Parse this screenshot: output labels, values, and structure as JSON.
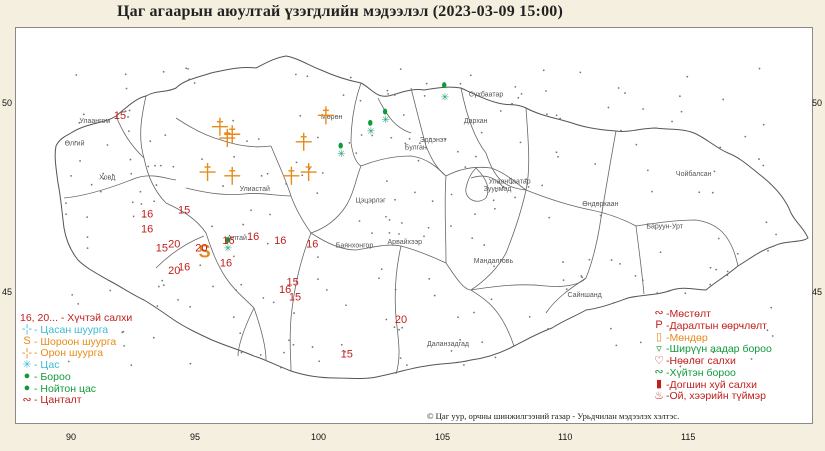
{
  "title": "Цаг агаарын аюултай үзэгдлийн мэдээлэл (2023-03-09 15:00)",
  "credit": "© Цаг уур, орчны шинжилгээний газар - Урьдчилан мэдээлэх хэлтэс.",
  "axes": {
    "lat_labels_left": [
      "50",
      "45"
    ],
    "lat_labels_right": [
      "50",
      "45"
    ],
    "lon_labels": [
      "90",
      "95",
      "100",
      "105",
      "110",
      "115"
    ]
  },
  "regions": [
    {
      "name": "Улаангом",
      "lon": 90.3,
      "lat": 49.5
    },
    {
      "name": "Өлгий",
      "lon": 89.7,
      "lat": 48.9
    },
    {
      "name": "Ховд",
      "lon": 91.1,
      "lat": 48.0
    },
    {
      "name": "Мөрөн",
      "lon": 100.1,
      "lat": 49.6
    },
    {
      "name": "Сүхбаатар",
      "lon": 106.1,
      "lat": 50.2
    },
    {
      "name": "Дархан",
      "lon": 105.9,
      "lat": 49.5
    },
    {
      "name": "Эрдэнэт",
      "lon": 104.1,
      "lat": 49.0
    },
    {
      "name": "Булган",
      "lon": 103.5,
      "lat": 48.8
    },
    {
      "name": "Улаанбаатар",
      "lon": 106.9,
      "lat": 47.9
    },
    {
      "name": "Зуунмод",
      "lon": 106.7,
      "lat": 47.7
    },
    {
      "name": "Баруун-Урт",
      "lon": 113.3,
      "lat": 46.7
    },
    {
      "name": "Чойбалсан",
      "lon": 114.5,
      "lat": 48.1
    },
    {
      "name": "Өндөрхаан",
      "lon": 110.7,
      "lat": 47.3
    },
    {
      "name": "Улиастай",
      "lon": 96.8,
      "lat": 47.7
    },
    {
      "name": "Алтай",
      "lon": 96.3,
      "lat": 46.4
    },
    {
      "name": "Арвайхээр",
      "lon": 102.8,
      "lat": 46.3
    },
    {
      "name": "Цэцэрлэг",
      "lon": 101.5,
      "lat": 47.4
    },
    {
      "name": "Баянхонгор",
      "lon": 100.7,
      "lat": 46.2
    },
    {
      "name": "Мандалговь",
      "lon": 106.3,
      "lat": 45.8
    },
    {
      "name": "Сайншанд",
      "lon": 110.1,
      "lat": 44.9
    },
    {
      "name": "Даланзадгад",
      "lon": 104.4,
      "lat": 43.6
    }
  ],
  "wind_labels": [
    {
      "text": "15",
      "lon": 91.7,
      "lat": 49.6
    },
    {
      "text": "15",
      "lon": 94.3,
      "lat": 47.1
    },
    {
      "text": "16",
      "lon": 92.8,
      "lat": 47.0
    },
    {
      "text": "16",
      "lon": 92.8,
      "lat": 46.6
    },
    {
      "text": "15",
      "lon": 93.4,
      "lat": 46.1
    },
    {
      "text": "20",
      "lon": 93.9,
      "lat": 46.2
    },
    {
      "text": "20",
      "lon": 95.0,
      "lat": 46.1
    },
    {
      "text": "16",
      "lon": 96.1,
      "lat": 46.3
    },
    {
      "text": "16",
      "lon": 97.1,
      "lat": 46.4
    },
    {
      "text": "16",
      "lon": 98.2,
      "lat": 46.3
    },
    {
      "text": "16",
      "lon": 99.5,
      "lat": 46.2
    },
    {
      "text": "16",
      "lon": 94.3,
      "lat": 45.6
    },
    {
      "text": "20",
      "lon": 93.9,
      "lat": 45.5
    },
    {
      "text": "16",
      "lon": 96.0,
      "lat": 45.7
    },
    {
      "text": "15",
      "lon": 98.7,
      "lat": 45.2
    },
    {
      "text": "16",
      "lon": 98.4,
      "lat": 45.0
    },
    {
      "text": "15",
      "lon": 98.8,
      "lat": 44.8
    },
    {
      "text": "20",
      "lon": 103.1,
      "lat": 44.2
    },
    {
      "text": "15",
      "lon": 100.9,
      "lat": 43.3
    }
  ],
  "markers": [
    {
      "type": "snowstorm",
      "lon": 96.0,
      "lat": 49.4
    },
    {
      "type": "snowstorm",
      "lon": 96.3,
      "lat": 49.1
    },
    {
      "type": "snowstorm",
      "lon": 96.5,
      "lat": 49.2
    },
    {
      "type": "snowstorm",
      "lon": 100.3,
      "lat": 49.7
    },
    {
      "type": "snowstorm",
      "lon": 99.4,
      "lat": 49.0
    },
    {
      "type": "snowstorm",
      "lon": 95.5,
      "lat": 48.2
    },
    {
      "type": "snowstorm",
      "lon": 96.5,
      "lat": 48.1
    },
    {
      "type": "snowstorm",
      "lon": 98.9,
      "lat": 48.1
    },
    {
      "type": "snowstorm",
      "lon": 99.6,
      "lat": 48.2
    },
    {
      "type": "duststorm",
      "lon": 95.3,
      "lat": 46.1
    },
    {
      "type": "rain",
      "lon": 102.1,
      "lat": 49.5
    },
    {
      "type": "rain",
      "lon": 102.7,
      "lat": 49.8
    },
    {
      "type": "rain",
      "lon": 105.1,
      "lat": 50.5
    },
    {
      "type": "rain",
      "lon": 100.9,
      "lat": 48.9
    },
    {
      "type": "rain",
      "lon": 96.3,
      "lat": 46.4
    },
    {
      "type": "snow",
      "lon": 102.1,
      "lat": 49.3
    },
    {
      "type": "snow",
      "lon": 102.7,
      "lat": 49.6
    },
    {
      "type": "snow",
      "lon": 105.1,
      "lat": 50.2
    },
    {
      "type": "snow",
      "lon": 100.9,
      "lat": 48.7
    },
    {
      "type": "snow",
      "lon": 96.3,
      "lat": 46.2
    }
  ],
  "legend_left": [
    {
      "icon": "",
      "color": "#c0201c",
      "label": "16, 20... - Хүчтэй салхи"
    },
    {
      "icon": "-¦-",
      "color": "#3dbbd6",
      "label": "- Цасан шуурга"
    },
    {
      "icon": "S",
      "color": "#e88a1a",
      "label": "- Шороон шуурга"
    },
    {
      "icon": "-¦-",
      "color": "#e88a1a",
      "label": "- Орон шуурга"
    },
    {
      "icon": "✳",
      "color": "#3dbbd6",
      "label": "- Цас"
    },
    {
      "icon": "●",
      "color": "#119a3a",
      "label": "- Бороо"
    },
    {
      "icon": "●",
      "color": "#119a3a",
      "label": "- Нойтон цас"
    },
    {
      "icon": "∾",
      "color": "#c0201c",
      "label": "- Цанталт"
    }
  ],
  "legend_right": [
    {
      "icon": "∾",
      "color": "#c0201c",
      "label": "-Мөстөлт"
    },
    {
      "icon": "P",
      "color": "#c0201c",
      "label": "-Даралтын өөрчлөлт"
    },
    {
      "icon": "▯",
      "color": "#e88a1a",
      "label": "-Мөндөр"
    },
    {
      "icon": "▿",
      "color": "#119a3a",
      "label": "-Ширүүн аадар бороо"
    },
    {
      "icon": "♡",
      "color": "#c0201c",
      "label": "-Нөөлөг салхи"
    },
    {
      "icon": "∾",
      "color": "#119a3a",
      "label": "-Хүйтэн бороо"
    },
    {
      "icon": "▮",
      "color": "#c0201c",
      "label": "-Догшин хуй салхи"
    },
    {
      "icon": "♨",
      "color": "#c0201c",
      "label": "-Ой, хээрийн түймэр"
    }
  ],
  "colors": {
    "wind": "#c0201c",
    "snowstorm": "#e88a1a",
    "rain": "#119a3a",
    "snow": "#2aa37a",
    "border": "#555555"
  }
}
